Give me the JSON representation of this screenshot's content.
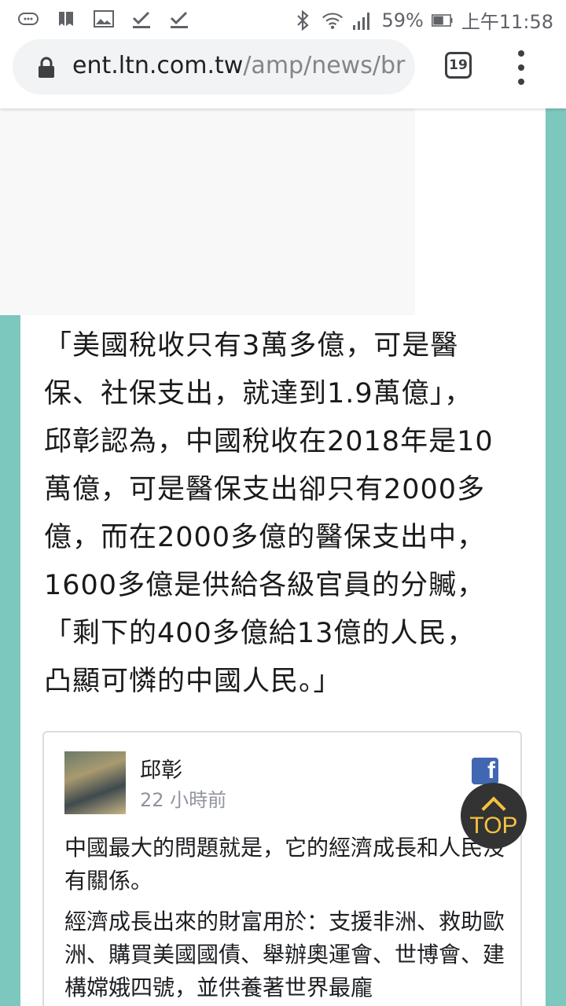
{
  "status_bar": {
    "battery": "59%",
    "time": "上午11:58"
  },
  "browser": {
    "url_host": "ent.ltn.com.tw",
    "url_path": "/amp/news/br",
    "tab_count": "19"
  },
  "article": {
    "lines": [
      "「美國稅收只有3萬多億，可是醫",
      "保、社保支出，就達到1.9萬億」，",
      "邱彰認為，中國稅收在2018年是10",
      "萬億，可是醫保支出卻只有2000多",
      "億，而在2000多億的醫保支出中，",
      "1600多億是供給各級官員的分贓，",
      "「剩下的400多億給13億的人民，",
      "凸顯可憐的中國人民。」"
    ]
  },
  "fb_post": {
    "author": "邱彰",
    "time": "22 小時前",
    "paragraph1": "中國最大的問題就是，它的經濟成長和人民沒有關係。",
    "paragraph2": "經濟成長出來的財富用於：支援非洲、救助歐洲、購買美國國債、舉辦奧運會、世博會、建構嫦娥四號，並供養著世界最龐"
  },
  "top_button": {
    "label": "TOP"
  }
}
